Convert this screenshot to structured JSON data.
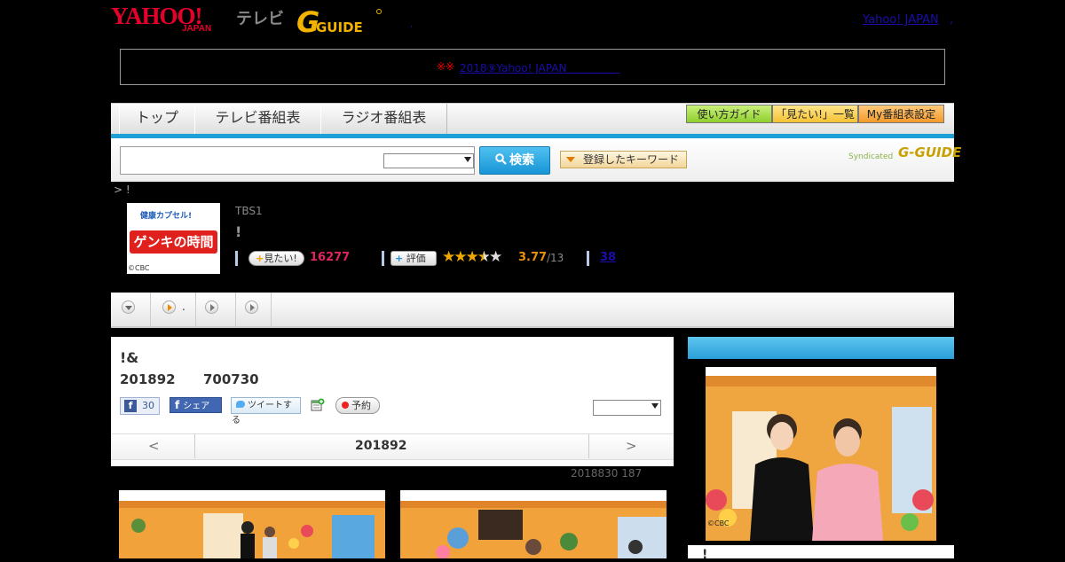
{
  "header": {
    "logo_yahoo": "YAHOO!",
    "logo_japan": "JAPAN",
    "logo_tv": "テレビ",
    "logo_gguide": "G-GUIDE",
    "yahoo_link": "Yahoo! JAPAN",
    "dot_left": ",",
    "dot_right": ","
  },
  "notice": {
    "marks": "※※",
    "link_text": "2018⑨Yahoo! JAPAN＿＿＿＿＿"
  },
  "nav": {
    "tabs": [
      "トップ",
      "テレビ番組表",
      "ラジオ番組表"
    ],
    "buttons": [
      "使い方ガイド",
      "「見たい!」一覧",
      "My番組表設定"
    ]
  },
  "search": {
    "button_label": "検索",
    "keyword_button": "登録したキーワード",
    "syndicated": "Syndicated",
    "syndicated_logo": "G-GUIDE"
  },
  "breadcrumb": "> !",
  "program": {
    "thumb_top": "健康カプセル!",
    "thumb_main": "ゲンキの時間",
    "thumb_copy": "©CBC",
    "channel": "TBS1",
    "title": "!",
    "want_label": "見たい!",
    "want_count": "16277",
    "rate_label": "評価",
    "rating": 3.77,
    "rating_text": "3.77",
    "rating_total": "/13",
    "link_count": "38"
  },
  "toolbar": {
    "item2_label": "."
  },
  "main": {
    "title": "!&",
    "date": "201892",
    "time": "700730",
    "fb_count": "30",
    "fb_share": "シェア",
    "tweet": "ツイートする",
    "reserve": "予約",
    "nav_prev": "<",
    "nav_date": "201892",
    "nav_next": ">",
    "updated": "2018830  187"
  },
  "side": {
    "copy": "©CBC",
    "footer_text": "!"
  },
  "colors": {
    "accent_blue": "#1da0d8",
    "yahoo_red": "#e5002b",
    "want_pink": "#e0245e",
    "rating_orange": "#e8900c"
  }
}
